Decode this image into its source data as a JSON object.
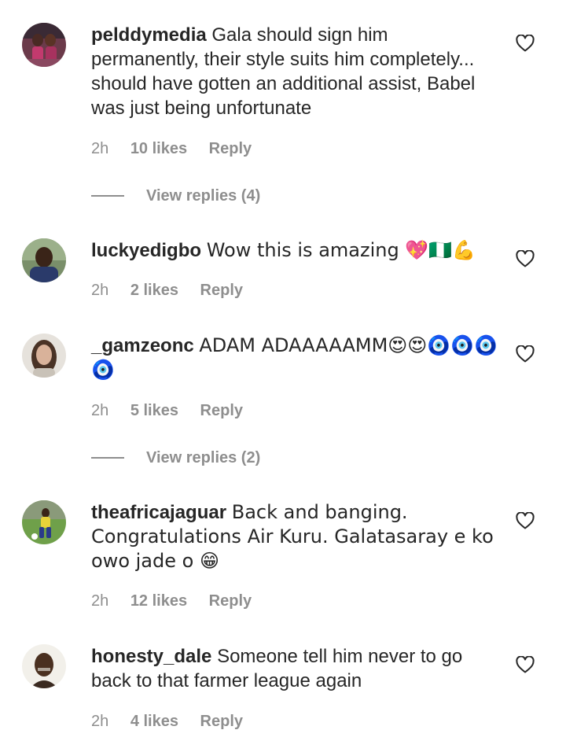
{
  "comments": [
    {
      "username": "pelddymedia",
      "text": "Gala should sign him permanently, their style suits him completely... should have gotten an additional assist, Babel was just being unfortunate",
      "time": "2h",
      "likes": "10 likes",
      "reply": "Reply",
      "view_replies": "View replies (4)"
    },
    {
      "username": "luckyedigbo",
      "text": "Wow this is amazing 💖🇳🇬💪",
      "time": "2h",
      "likes": "2 likes",
      "reply": "Reply"
    },
    {
      "username": "_gamzeonc",
      "text": "ADAM ADAAAAAMM😍😍🧿🧿🧿🧿",
      "time": "2h",
      "likes": "5 likes",
      "reply": "Reply",
      "view_replies": "View replies (2)"
    },
    {
      "username": "theafricajaguar",
      "text": "Back and banging. Congratulations Air Kuru. Galatasaray e ko owo jade o 😁",
      "time": "2h",
      "likes": "12 likes",
      "reply": "Reply"
    },
    {
      "username": "honesty_dale",
      "text": "Someone tell him never to go back to that farmer league again",
      "time": "2h",
      "likes": "4 likes",
      "reply": "Reply"
    }
  ],
  "icons": {
    "like": "heart-outline-icon"
  },
  "colors": {
    "text": "#262626",
    "meta": "#8e8e8e",
    "background": "#ffffff"
  }
}
